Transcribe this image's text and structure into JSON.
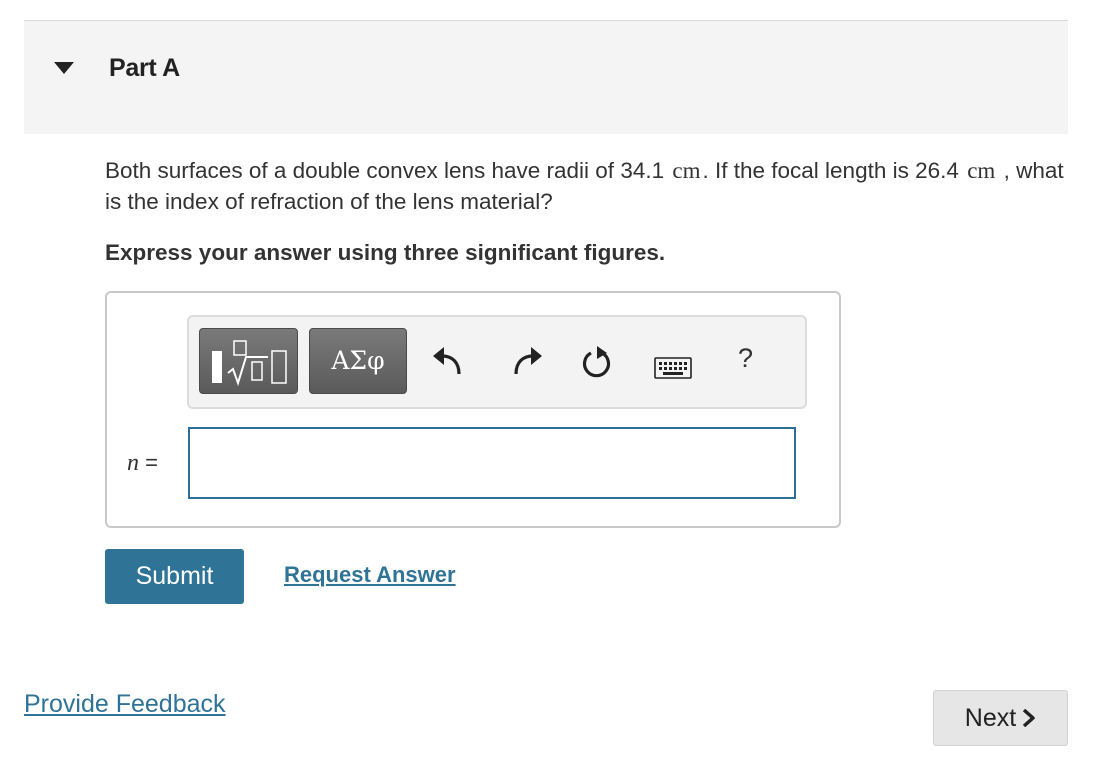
{
  "part": {
    "title": "Part A",
    "expanded": true
  },
  "question": {
    "text_1": "Both surfaces of a double convex lens have radii of 34.1",
    "unit_1": "cm",
    "text_2": ". If the focal length is",
    "value_2": "26.4",
    "unit_2": "cm",
    "text_3": ", what is the index of refraction of the lens material?"
  },
  "instruction": "Express your answer using three significant figures.",
  "toolbar": {
    "templates_icon": "fraction-sqrt-icon",
    "greek_label": "ΑΣφ",
    "undo_icon": "undo-icon",
    "redo_icon": "redo-icon",
    "reset_icon": "reset-icon",
    "keyboard_icon": "keyboard-icon",
    "help_label": "?"
  },
  "answer": {
    "variable": "n",
    "equals": "=",
    "value": "",
    "placeholder": ""
  },
  "actions": {
    "submit_label": "Submit",
    "request_label": "Request Answer"
  },
  "footer": {
    "feedback_label": "Provide Feedback",
    "next_label": "Next"
  },
  "colors": {
    "accent": "#2f7396",
    "header_bg": "#f4f4f4",
    "input_border": "#2e6e97",
    "next_bg": "#e6e6e6"
  }
}
